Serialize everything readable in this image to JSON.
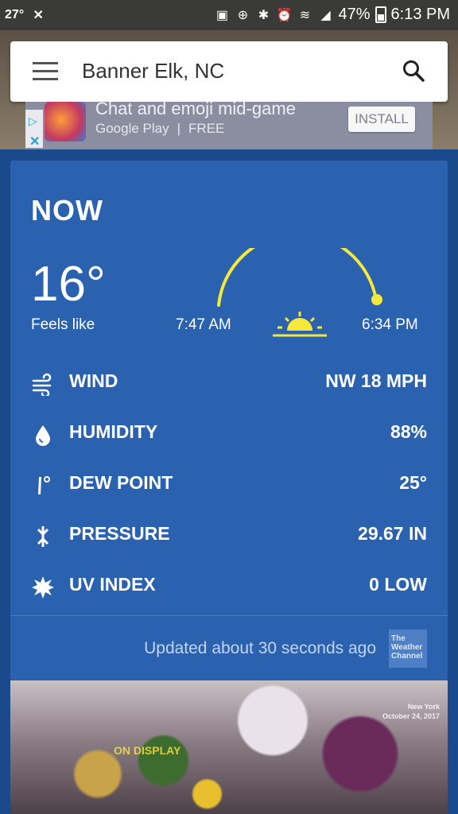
{
  "status_bar": {
    "temperature": "27°",
    "battery_percent": "47%",
    "time": "6:13 PM"
  },
  "search": {
    "location": "Banner Elk, NC"
  },
  "ad": {
    "title": "Chat and emoji mid-game",
    "store": "Google Play",
    "price": "FREE",
    "install_label": "INSTALL"
  },
  "now": {
    "title": "NOW",
    "temperature": "16°",
    "feels_like_label": "Feels like",
    "sunrise": "7:47 AM",
    "sunset": "6:34 PM",
    "accent_color": "#f5e83a"
  },
  "conditions": [
    {
      "icon": "wind-icon",
      "label": "WIND",
      "value": "NW 18 MPH"
    },
    {
      "icon": "humidity-drop-icon",
      "label": "HUMIDITY",
      "value": "88%"
    },
    {
      "icon": "dew-point-icon",
      "label": "DEW POINT",
      "value": "25°"
    },
    {
      "icon": "pressure-icon",
      "label": "PRESSURE",
      "value": "29.67 IN"
    },
    {
      "icon": "uv-sun-icon",
      "label": "UV INDEX",
      "value": "0 LOW"
    }
  ],
  "footer": {
    "updated_text": "Updated about 30 seconds ago",
    "logo_text": "The Weather Channel"
  },
  "photo": {
    "overlay_text_1": "ON DISPLAY",
    "overlay_text_2": "New York",
    "overlay_text_3": "October 24, 2017"
  }
}
